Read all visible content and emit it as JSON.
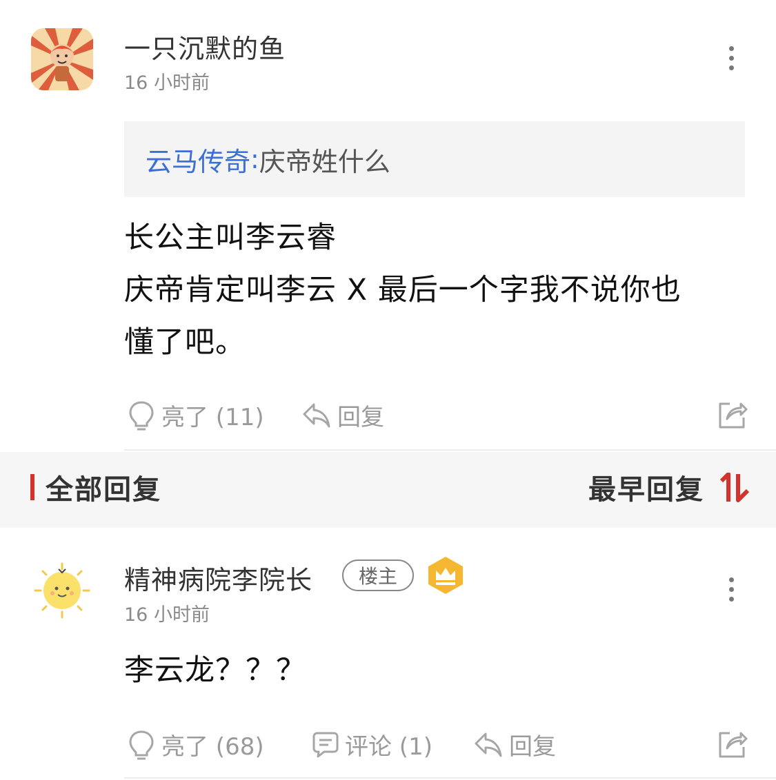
{
  "comment": {
    "username": "一只沉默的鱼",
    "time": "16 小时前",
    "quote": {
      "name": "云马传奇",
      "separator": ": ",
      "text": "庆帝姓什么"
    },
    "body_lines": [
      "长公主叫李云睿",
      "庆帝肯定叫李云 X 最后一个字我不说你也",
      "懂了吧。"
    ],
    "actions": {
      "light": "亮了 (11)",
      "reply": "回复"
    }
  },
  "replies_header": {
    "title": "全部回复",
    "sort": "最早回复"
  },
  "reply": {
    "username": "精神病院李院长",
    "op_badge": "楼主",
    "time": "16 小时前",
    "body": "李云龙？？？",
    "actions": {
      "light": "亮了 (68)",
      "comment": "评论 (1)",
      "reply": "回复"
    }
  },
  "colors": {
    "link": "#3a6fd8",
    "accent": "#d4322c",
    "crown": "#f5b731"
  },
  "icons": [
    "more-vertical-icon",
    "lightbulb-icon",
    "reply-arrow-icon",
    "share-icon",
    "sort-icon",
    "comment-icon",
    "crown-icon"
  ]
}
